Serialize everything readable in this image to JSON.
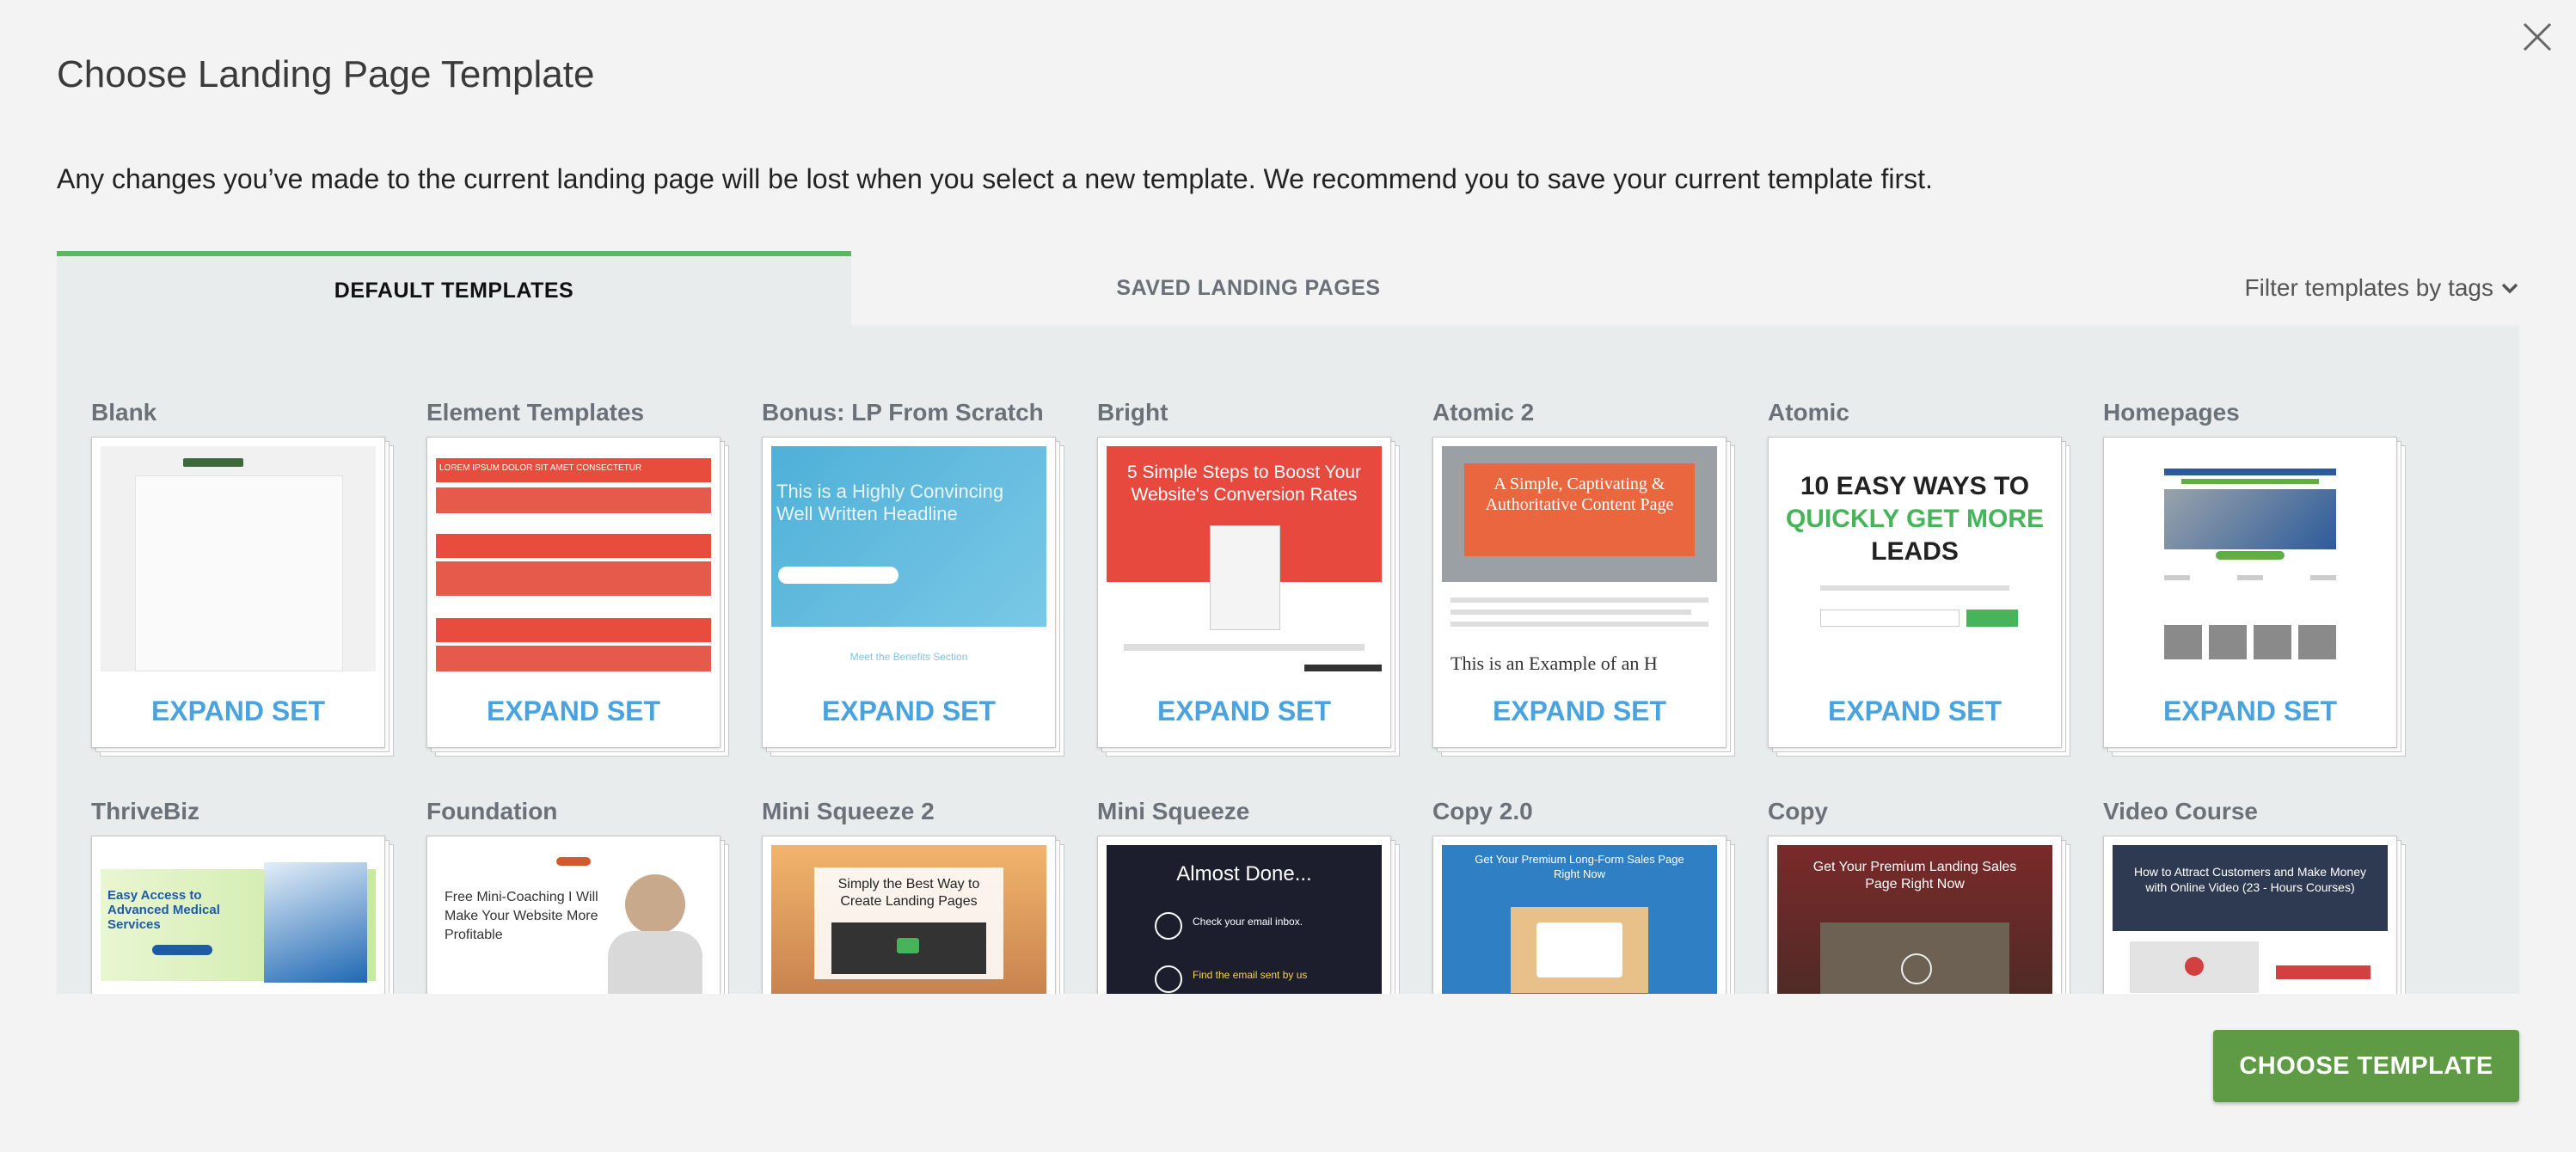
{
  "dialog": {
    "title": "Choose Landing Page Template",
    "notice": "Any changes you’ve made to the current landing page will be lost when you select a new template. We recommend you to save your current template first.",
    "close_icon": "close-icon"
  },
  "tabs": [
    {
      "label": "DEFAULT TEMPLATES",
      "active": true
    },
    {
      "label": "SAVED LANDING PAGES",
      "active": false
    }
  ],
  "filter": {
    "label": "Filter templates by tags",
    "icon": "chevron-down-icon"
  },
  "template_sets": [
    {
      "name": "Blank",
      "action": "EXPAND SET"
    },
    {
      "name": "Element Templates",
      "action": "EXPAND SET"
    },
    {
      "name": "Bonus: LP From Scratch",
      "action": "EXPAND SET"
    },
    {
      "name": "Bright",
      "action": "EXPAND SET"
    },
    {
      "name": "Atomic 2",
      "action": "EXPAND SET"
    },
    {
      "name": "Atomic",
      "action": "EXPAND SET"
    },
    {
      "name": "Homepages",
      "action": "EXPAND SET"
    },
    {
      "name": "ThriveBiz",
      "action": ""
    },
    {
      "name": "Foundation",
      "action": ""
    },
    {
      "name": "Mini Squeeze 2",
      "action": ""
    },
    {
      "name": "Mini Squeeze",
      "action": ""
    },
    {
      "name": "Copy 2.0",
      "action": ""
    },
    {
      "name": "Copy",
      "action": ""
    },
    {
      "name": "Video Course",
      "action": ""
    }
  ],
  "thumb_text": {
    "bonus": "This is a Highly Convincing Well Written Headline",
    "bonus_sub": "Meet the Benefits Section",
    "bright_head": "5 Simple Steps to Boost Your Website's Conversion Rates",
    "atomic2_head": "A Simple, Captivating & Authoritative Content Page",
    "atomic2_sub": "This is an Example of an H",
    "atomic_line1": "10 EASY WAYS TO",
    "atomic_line2": "QUICKLY GET MORE",
    "atomic_line3": "LEADS",
    "thrivebiz": "Easy Access to Advanced Medical Services",
    "foundation": "Free Mini-Coaching I Will Make Your Website More Profitable",
    "mini2": "Simply the Best Way to Create Landing Pages",
    "mini": "Almost Done...",
    "mini_sub": "Check your email inbox.",
    "mini_sub2": "Find the email sent by us",
    "copy2": "Get Your Premium Long-Form Sales Page Right Now",
    "copy": "Get Your Premium Landing Sales Page Right Now",
    "video": "How to Attract Customers and Make Money with Online Video (23 - Hours Courses)",
    "element_bar": "LOREM IPSUM DOLOR SIT AMET CONSECTETUR"
  },
  "footer": {
    "choose_button": "CHOOSE TEMPLATE"
  },
  "colors": {
    "accent_green": "#5cb85c",
    "button_green": "#5f9a45",
    "link_blue": "#4aa3df"
  }
}
